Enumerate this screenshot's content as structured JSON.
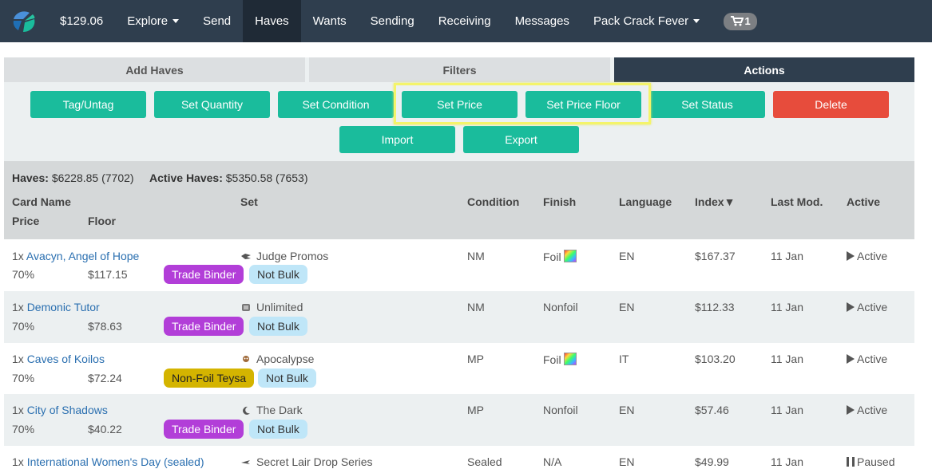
{
  "navbar": {
    "balance": "$129.06",
    "items": [
      "Explore",
      "Send",
      "Haves",
      "Wants",
      "Sending",
      "Receiving",
      "Messages",
      "Pack Crack Fever"
    ],
    "cart_count": "1"
  },
  "tabs": [
    "Add Haves",
    "Filters",
    "Actions"
  ],
  "actions": [
    "Tag/Untag",
    "Set Quantity",
    "Set Condition",
    "Set Price",
    "Set Price Floor",
    "Set Status",
    "Delete",
    "Import",
    "Export"
  ],
  "summary": {
    "haves_label": "Haves:",
    "haves_value": "$6228.85 (7702)",
    "active_label": "Active Haves:",
    "active_value": "$5350.58 (7653)"
  },
  "columns": {
    "card_name": "Card Name",
    "set": "Set",
    "condition": "Condition",
    "finish": "Finish",
    "language": "Language",
    "index": "Index▼",
    "last_mod": "Last Mod.",
    "active": "Active",
    "price": "Price",
    "floor": "Floor"
  },
  "rows": [
    {
      "qty": "1x",
      "name": "Avacyn, Angel of Hope",
      "set": "Judge Promos",
      "condition": "NM",
      "finish": "Foil",
      "foil": true,
      "language": "EN",
      "index": "$167.37",
      "last_mod": "11 Jan",
      "status": "Active",
      "price": "70%",
      "floor": "$117.15",
      "tags": [
        {
          "label": "Trade Binder",
          "style": "purple"
        },
        {
          "label": "Not Bulk",
          "style": "blue"
        }
      ]
    },
    {
      "qty": "1x",
      "name": "Demonic Tutor",
      "set": "Unlimited",
      "condition": "NM",
      "finish": "Nonfoil",
      "foil": false,
      "language": "EN",
      "index": "$112.33",
      "last_mod": "11 Jan",
      "status": "Active",
      "price": "70%",
      "floor": "$78.63",
      "tags": [
        {
          "label": "Trade Binder",
          "style": "purple"
        },
        {
          "label": "Not Bulk",
          "style": "blue"
        }
      ]
    },
    {
      "qty": "1x",
      "name": "Caves of Koilos",
      "set": "Apocalypse",
      "condition": "MP",
      "finish": "Foil",
      "foil": true,
      "language": "IT",
      "index": "$103.20",
      "last_mod": "11 Jan",
      "status": "Active",
      "price": "70%",
      "floor": "$72.24",
      "tags": [
        {
          "label": "Non-Foil Teysa",
          "style": "gold"
        },
        {
          "label": "Not Bulk",
          "style": "blue"
        }
      ]
    },
    {
      "qty": "1x",
      "name": "City of Shadows",
      "set": "The Dark",
      "condition": "MP",
      "finish": "Nonfoil",
      "foil": false,
      "language": "EN",
      "index": "$57.46",
      "last_mod": "11 Jan",
      "status": "Active",
      "price": "70%",
      "floor": "$40.22",
      "tags": [
        {
          "label": "Trade Binder",
          "style": "purple"
        },
        {
          "label": "Not Bulk",
          "style": "blue"
        }
      ]
    },
    {
      "qty": "1x",
      "name": "International Women's Day (sealed)",
      "set": "Secret Lair Drop Series",
      "condition": "Sealed",
      "finish": "N/A",
      "foil": false,
      "language": "EN",
      "index": "$49.99",
      "last_mod": "11 Jan",
      "status": "Paused",
      "price": "",
      "floor": "",
      "tags": []
    }
  ]
}
